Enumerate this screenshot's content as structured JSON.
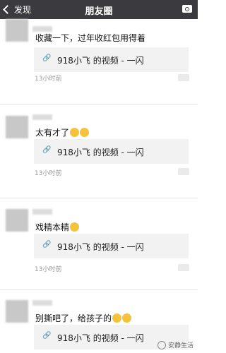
{
  "nav": {
    "back_label": "发现",
    "title": "朋友圈"
  },
  "posts": [
    {
      "text": "收藏一下，过年收红包用得着",
      "emoji_count": 0,
      "link_text": "918小飞 的视频 - 一闪",
      "time": "13小时前"
    },
    {
      "text": "太有才了",
      "emoji_count": 2,
      "link_text": "918小飞 的视频 - 一闪",
      "time": "13小时前"
    },
    {
      "text": "戏精本精",
      "emoji_count": 1,
      "link_text": "918小飞 的视频 - 一闪",
      "time": "13小时前"
    },
    {
      "text": "别撕吧了，给孩子的",
      "emoji_count": 2,
      "link_text": "918小飞 的视频 - 一闪",
      "time": ""
    }
  ],
  "watermark": "安静生活",
  "colors": {
    "nav_bg": "#3b3b3f",
    "card_bg": "#f2f2f2",
    "time": "#9a9a9a",
    "emoji": "#f5c23a"
  }
}
